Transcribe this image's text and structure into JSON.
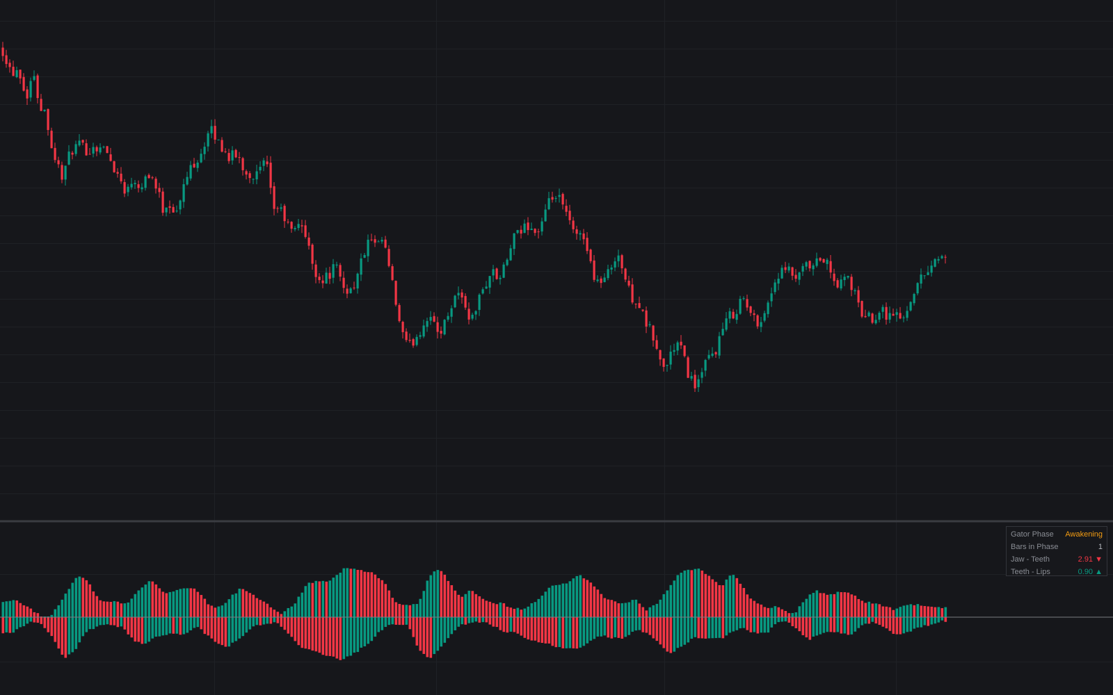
{
  "panel": {
    "phase_label": "Gator Phase",
    "phase_value": "Awakening",
    "bars_label": "Bars in Phase",
    "bars_value": "1",
    "jaw_label": "Jaw - Teeth",
    "jaw_value": "2.91 ▼",
    "lips_label": "Teeth - Lips",
    "lips_value": "0.90 ▲"
  },
  "colors": {
    "up": "#089981",
    "down": "#f23645",
    "phase": "#f39c12",
    "background": "#16171b"
  },
  "chart_data": [
    {
      "type": "candlestick",
      "title": "",
      "xlabel": "",
      "ylabel": "",
      "grid": true,
      "ylim": [
        0,
        100
      ],
      "note_values": "relative price units estimated from the figure (no axis labels visible)",
      "close_points": [
        [
          0,
          91
        ],
        [
          15,
          86
        ],
        [
          25,
          87
        ],
        [
          35,
          81
        ],
        [
          45,
          86
        ],
        [
          55,
          80
        ],
        [
          65,
          78
        ],
        [
          70,
          73
        ],
        [
          78,
          69
        ],
        [
          88,
          66
        ],
        [
          100,
          71
        ],
        [
          110,
          72
        ],
        [
          125,
          71
        ],
        [
          140,
          72
        ],
        [
          150,
          71
        ],
        [
          165,
          67
        ],
        [
          180,
          63
        ],
        [
          190,
          66
        ],
        [
          200,
          64
        ],
        [
          210,
          67
        ],
        [
          220,
          65
        ],
        [
          232,
          60
        ],
        [
          240,
          61
        ],
        [
          252,
          59
        ],
        [
          262,
          64
        ],
        [
          272,
          68
        ],
        [
          285,
          70
        ],
        [
          300,
          75
        ],
        [
          306,
          74
        ],
        [
          315,
          72
        ],
        [
          325,
          70
        ],
        [
          340,
          70
        ],
        [
          350,
          67
        ],
        [
          365,
          66
        ],
        [
          380,
          69
        ],
        [
          385,
          65
        ],
        [
          390,
          60
        ],
        [
          400,
          60
        ],
        [
          410,
          57
        ],
        [
          420,
          55
        ],
        [
          430,
          58
        ],
        [
          440,
          53
        ],
        [
          450,
          48
        ],
        [
          460,
          46
        ],
        [
          470,
          47
        ],
        [
          480,
          49
        ],
        [
          490,
          45
        ],
        [
          500,
          44
        ],
        [
          510,
          46
        ],
        [
          520,
          51
        ],
        [
          530,
          54
        ],
        [
          540,
          52
        ],
        [
          548,
          54
        ],
        [
          555,
          50
        ],
        [
          565,
          43
        ],
        [
          575,
          36
        ],
        [
          585,
          33
        ],
        [
          595,
          35
        ],
        [
          605,
          37
        ],
        [
          615,
          40
        ],
        [
          625,
          36
        ],
        [
          635,
          37
        ],
        [
          645,
          41
        ],
        [
          655,
          44
        ],
        [
          665,
          42
        ],
        [
          675,
          38
        ],
        [
          685,
          42
        ],
        [
          695,
          45
        ],
        [
          705,
          48
        ],
        [
          715,
          46
        ],
        [
          725,
          49
        ],
        [
          735,
          54
        ],
        [
          745,
          55
        ],
        [
          755,
          57
        ],
        [
          770,
          55
        ],
        [
          780,
          58
        ],
        [
          790,
          62
        ],
        [
          800,
          62
        ],
        [
          815,
          58
        ],
        [
          825,
          54
        ],
        [
          835,
          56
        ],
        [
          845,
          50
        ],
        [
          855,
          46
        ],
        [
          865,
          46
        ],
        [
          875,
          48
        ],
        [
          885,
          52
        ],
        [
          895,
          47
        ],
        [
          905,
          43
        ],
        [
          915,
          42
        ],
        [
          925,
          38
        ],
        [
          935,
          36
        ],
        [
          945,
          31
        ],
        [
          955,
          29
        ],
        [
          965,
          33
        ],
        [
          975,
          34
        ],
        [
          985,
          29
        ],
        [
          995,
          26
        ],
        [
          1005,
          27
        ],
        [
          1015,
          31
        ],
        [
          1025,
          32
        ],
        [
          1035,
          36
        ],
        [
          1045,
          39
        ],
        [
          1055,
          40
        ],
        [
          1065,
          43
        ],
        [
          1075,
          40
        ],
        [
          1085,
          38
        ],
        [
          1095,
          39
        ],
        [
          1105,
          43
        ],
        [
          1115,
          47
        ],
        [
          1130,
          48
        ],
        [
          1145,
          46
        ],
        [
          1155,
          49
        ],
        [
          1165,
          48
        ],
        [
          1175,
          50
        ],
        [
          1185,
          50
        ],
        [
          1195,
          46
        ],
        [
          1205,
          45
        ],
        [
          1215,
          47
        ],
        [
          1225,
          44
        ],
        [
          1235,
          40
        ],
        [
          1245,
          39
        ],
        [
          1255,
          39
        ],
        [
          1265,
          41
        ],
        [
          1275,
          39
        ],
        [
          1285,
          40
        ],
        [
          1295,
          38
        ],
        [
          1305,
          42
        ],
        [
          1315,
          45
        ],
        [
          1325,
          47
        ],
        [
          1335,
          49
        ],
        [
          1352,
          51
        ]
      ]
    },
    {
      "type": "bar",
      "title": "",
      "series_upper": "Jaw - Teeth",
      "series_lower": "Teeth - Lips",
      "ylim": [
        -4,
        4
      ],
      "grid": true,
      "upper_points": [
        [
          0,
          1.0
        ],
        [
          20,
          1.2
        ],
        [
          40,
          0.7
        ],
        [
          55,
          0.1
        ],
        [
          70,
          0.0
        ],
        [
          90,
          1.5
        ],
        [
          110,
          3.0
        ],
        [
          125,
          2.5
        ],
        [
          140,
          1.2
        ],
        [
          160,
          1.1
        ],
        [
          180,
          1.0
        ],
        [
          200,
          2.0
        ],
        [
          215,
          2.7
        ],
        [
          235,
          1.7
        ],
        [
          260,
          2.1
        ],
        [
          280,
          2.0
        ],
        [
          300,
          0.8
        ],
        [
          315,
          0.7
        ],
        [
          330,
          1.5
        ],
        [
          345,
          2.1
        ],
        [
          365,
          1.5
        ],
        [
          385,
          0.8
        ],
        [
          400,
          0.2
        ],
        [
          420,
          0.9
        ],
        [
          440,
          2.4
        ],
        [
          455,
          2.6
        ],
        [
          470,
          2.5
        ],
        [
          495,
          3.6
        ],
        [
          510,
          3.4
        ],
        [
          530,
          3.3
        ],
        [
          550,
          2.5
        ],
        [
          565,
          1.1
        ],
        [
          585,
          0.8
        ],
        [
          600,
          1.0
        ],
        [
          615,
          3.0
        ],
        [
          630,
          3.5
        ],
        [
          645,
          2.4
        ],
        [
          660,
          1.4
        ],
        [
          675,
          2.0
        ],
        [
          690,
          1.3
        ],
        [
          705,
          1.0
        ],
        [
          720,
          1.0
        ],
        [
          735,
          0.6
        ],
        [
          750,
          0.6
        ],
        [
          770,
          1.2
        ],
        [
          790,
          2.2
        ],
        [
          810,
          2.4
        ],
        [
          830,
          3.0
        ],
        [
          845,
          2.6
        ],
        [
          865,
          1.5
        ],
        [
          880,
          1.1
        ],
        [
          895,
          1.0
        ],
        [
          910,
          1.3
        ],
        [
          925,
          0.5
        ],
        [
          940,
          0.9
        ],
        [
          955,
          1.8
        ],
        [
          970,
          2.9
        ],
        [
          985,
          3.4
        ],
        [
          1005,
          3.5
        ],
        [
          1020,
          2.8
        ],
        [
          1035,
          2.2
        ],
        [
          1050,
          3.2
        ],
        [
          1060,
          2.6
        ],
        [
          1075,
          1.4
        ],
        [
          1090,
          0.9
        ],
        [
          1100,
          0.6
        ],
        [
          1115,
          0.8
        ],
        [
          1125,
          0.4
        ],
        [
          1140,
          0.2
        ],
        [
          1155,
          1.3
        ],
        [
          1170,
          1.9
        ],
        [
          1190,
          1.6
        ],
        [
          1205,
          1.8
        ],
        [
          1220,
          1.7
        ],
        [
          1240,
          1.1
        ],
        [
          1255,
          1.0
        ],
        [
          1270,
          0.8
        ],
        [
          1285,
          0.5
        ],
        [
          1300,
          0.9
        ],
        [
          1315,
          0.9
        ],
        [
          1330,
          0.8
        ],
        [
          1345,
          0.7
        ],
        [
          1352,
          0.7
        ]
      ],
      "lower_points": [
        [
          0,
          -1.2
        ],
        [
          15,
          -1.1
        ],
        [
          30,
          -0.7
        ],
        [
          45,
          -0.3
        ],
        [
          60,
          -0.6
        ],
        [
          75,
          -1.6
        ],
        [
          90,
          -3.0
        ],
        [
          105,
          -2.4
        ],
        [
          120,
          -1.1
        ],
        [
          140,
          -0.6
        ],
        [
          160,
          -0.5
        ],
        [
          175,
          -0.8
        ],
        [
          190,
          -1.7
        ],
        [
          205,
          -2.0
        ],
        [
          220,
          -1.4
        ],
        [
          240,
          -1.2
        ],
        [
          260,
          -1.3
        ],
        [
          280,
          -0.6
        ],
        [
          295,
          -1.3
        ],
        [
          310,
          -1.9
        ],
        [
          325,
          -2.1
        ],
        [
          345,
          -1.5
        ],
        [
          360,
          -0.7
        ],
        [
          380,
          -0.5
        ],
        [
          395,
          -0.3
        ],
        [
          410,
          -1.0
        ],
        [
          430,
          -2.2
        ],
        [
          450,
          -2.5
        ],
        [
          470,
          -2.8
        ],
        [
          490,
          -3.1
        ],
        [
          510,
          -2.5
        ],
        [
          530,
          -1.8
        ],
        [
          550,
          -0.7
        ],
        [
          570,
          -0.5
        ],
        [
          585,
          -0.6
        ],
        [
          600,
          -2.4
        ],
        [
          615,
          -3.0
        ],
        [
          630,
          -2.3
        ],
        [
          645,
          -1.3
        ],
        [
          660,
          -0.6
        ],
        [
          680,
          -0.3
        ],
        [
          700,
          -0.4
        ],
        [
          720,
          -1.0
        ],
        [
          740,
          -1.1
        ],
        [
          760,
          -1.7
        ],
        [
          780,
          -1.8
        ],
        [
          800,
          -2.2
        ],
        [
          820,
          -2.3
        ],
        [
          840,
          -2.0
        ],
        [
          860,
          -1.3
        ],
        [
          875,
          -1.5
        ],
        [
          895,
          -1.5
        ],
        [
          910,
          -0.9
        ],
        [
          925,
          -1.1
        ],
        [
          945,
          -1.8
        ],
        [
          960,
          -2.6
        ],
        [
          975,
          -2.2
        ],
        [
          995,
          -1.5
        ],
        [
          1015,
          -1.6
        ],
        [
          1035,
          -1.5
        ],
        [
          1050,
          -1.1
        ],
        [
          1065,
          -0.7
        ],
        [
          1080,
          -1.1
        ],
        [
          1100,
          -1.2
        ],
        [
          1115,
          -0.3
        ],
        [
          1130,
          -0.3
        ],
        [
          1145,
          -1.0
        ],
        [
          1160,
          -1.6
        ],
        [
          1180,
          -1.2
        ],
        [
          1200,
          -1.0
        ],
        [
          1220,
          -1.3
        ],
        [
          1240,
          -0.4
        ],
        [
          1255,
          -0.4
        ],
        [
          1270,
          -0.8
        ],
        [
          1285,
          -1.3
        ],
        [
          1300,
          -1.1
        ],
        [
          1315,
          -0.8
        ],
        [
          1330,
          -0.6
        ],
        [
          1345,
          -0.5
        ],
        [
          1352,
          -0.3
        ]
      ]
    }
  ]
}
